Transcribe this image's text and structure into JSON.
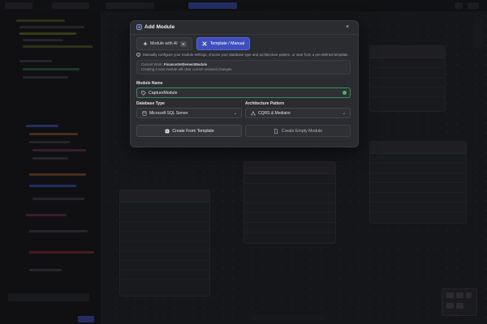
{
  "modal": {
    "title": "Add Module",
    "close_glyph": "×",
    "tabs": [
      {
        "label": "Module with AI",
        "shortcut": "⌘",
        "active": false,
        "icon": "sparkle-icon"
      },
      {
        "label": "Template / Manual",
        "active": true,
        "icon": "tools-icon"
      }
    ],
    "info_text": "Manually configure your module settings, choose your database type and architecture pattern, or start from a pre-defined template.",
    "current_work_label": "Current Work:",
    "current_work_value": "FinanceSettlementModule",
    "current_work_note": "Creating a new module will clear current unsaved changes.",
    "module_name_label": "Module Name",
    "module_name_value": "CaptureModule",
    "database_type_label": "Database Type",
    "database_type_value": "Microsoft SQL Server",
    "architecture_label": "Architecture Pattern",
    "architecture_value": "CQRS & Mediator",
    "create_template_label": "Create From Template",
    "create_empty_label": "Create Empty Module"
  },
  "colors": {
    "accent": "#3e4fbd",
    "valid": "#3fb96d",
    "modal_bg": "#2b2c30"
  }
}
